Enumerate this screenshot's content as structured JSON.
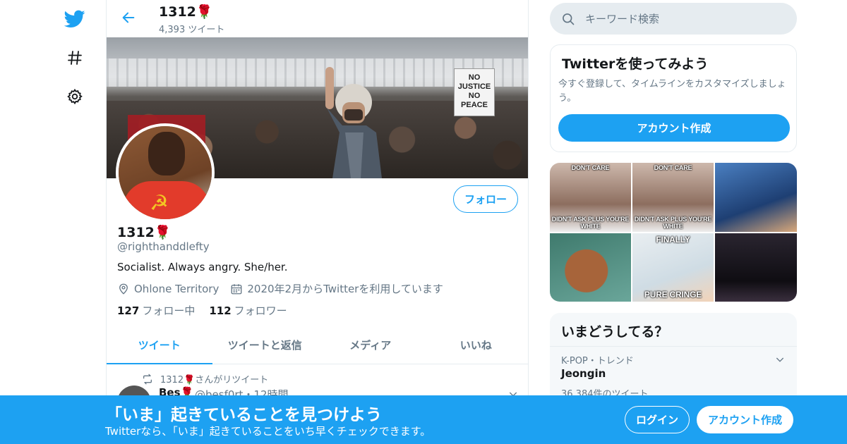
{
  "colors": {
    "accent": "#1da1f2",
    "text": "#14171a",
    "muted": "#657786",
    "border": "#e6ecf0"
  },
  "nav": {
    "icons": [
      "twitter-logo-icon",
      "hashtag-icon",
      "gear-icon"
    ]
  },
  "header": {
    "name": "1312🌹",
    "tweet_count": "4,393 ツイート"
  },
  "banner": {
    "sign_text": "NO JUSTICE NO PEACE"
  },
  "profile": {
    "follow_label": "フォロー",
    "name": "1312🌹",
    "handle": "@righthanddlefty",
    "bio": "Socialist. Always angry. She/her.",
    "location": "Ohlone Territory",
    "joined": "2020年2月からTwitterを利用しています",
    "following_count": "127",
    "following_label": "フォロー中",
    "followers_count": "112",
    "followers_label": "フォロワー"
  },
  "tabs": [
    {
      "label": "ツイート",
      "active": true
    },
    {
      "label": "ツイートと返信",
      "active": false
    },
    {
      "label": "メディア",
      "active": false
    },
    {
      "label": "いいね",
      "active": false
    }
  ],
  "timeline": {
    "retweet_line": "1312🌹さんがリツイート",
    "author": "Bes🌹",
    "meta": "@besf0rt・12時間"
  },
  "sidebar": {
    "search_placeholder": "キーワード検索",
    "signup_card": {
      "title": "Twitterを使ってみよう",
      "desc": "今すぐ登録して、タイムラインをカスタマイズしましょう。",
      "button": "アカウント作成"
    },
    "media": [
      {
        "top": "DON'T CARE",
        "bottom": "DIDN'T ASK PLUS YOU'RE WHITE"
      },
      {
        "top": "DON'T CARE",
        "bottom": "DIDN'T ASK PLUS YOU'RE WHITE"
      },
      {
        "top": "",
        "bottom": ""
      },
      {
        "top": "",
        "bottom": ""
      },
      {
        "top": "FINALLY",
        "bottom": "PURE CRINGE"
      },
      {
        "top": "",
        "bottom": ""
      }
    ],
    "trends": {
      "title": "いまどうしてる？",
      "category": "K-POP・トレンド",
      "name": "Jeongin",
      "count": "36,384件のツイート"
    }
  },
  "bottom_bar": {
    "headline": "「いま」起きていることを見つけよう",
    "sub": "Twitterなら、「いま」起きていることをいち早くチェックできます。",
    "login": "ログイン",
    "signup": "アカウント作成"
  }
}
